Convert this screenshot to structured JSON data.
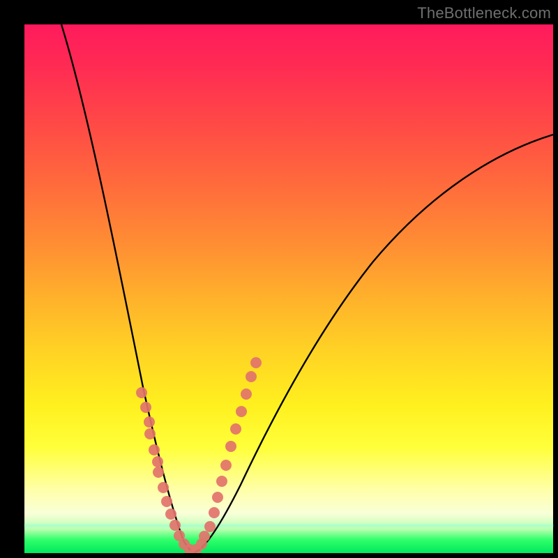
{
  "watermark": "TheBottleneck.com",
  "chart_data": {
    "type": "line",
    "title": "",
    "xlabel": "",
    "ylabel": "",
    "xlim": [
      0,
      100
    ],
    "ylim": [
      0,
      100
    ],
    "grid": false,
    "legend": false,
    "background_gradient": {
      "direction": "vertical",
      "stops": [
        {
          "pos": 0,
          "color": "#ff1f5a"
        },
        {
          "pos": 30,
          "color": "#ff6a3c"
        },
        {
          "pos": 62,
          "color": "#ffd324"
        },
        {
          "pos": 88,
          "color": "#ffffa8"
        },
        {
          "pos": 97,
          "color": "#2fff6a"
        },
        {
          "pos": 100,
          "color": "#00e85e"
        }
      ]
    },
    "series": [
      {
        "name": "left-branch",
        "stroke": "#000000",
        "x": [
          7,
          9,
          11,
          13,
          15,
          17,
          19,
          21,
          23,
          25,
          27,
          28.5,
          30,
          31
        ],
        "y": [
          100,
          90,
          80,
          70,
          60,
          50,
          40,
          31,
          23,
          15,
          8,
          4,
          1,
          0
        ]
      },
      {
        "name": "right-branch",
        "stroke": "#000000",
        "x": [
          31,
          33,
          36,
          40,
          45,
          51,
          58,
          66,
          75,
          85,
          95,
          100
        ],
        "y": [
          0,
          2,
          6,
          13,
          22,
          32,
          42,
          52,
          61,
          69,
          76,
          79
        ]
      },
      {
        "name": "left-dot-cluster",
        "type": "scatter",
        "color": "#e2736b",
        "x": [
          21.5,
          22.3,
          23.0,
          23.0,
          23.8,
          24.5,
          24.5,
          25.5,
          26.2,
          27.0,
          27.8,
          28.6,
          29.5,
          30.5
        ],
        "y": [
          30,
          27,
          24,
          22,
          19,
          17,
          15,
          12,
          9,
          7,
          5,
          3,
          1.5,
          0.5
        ]
      },
      {
        "name": "right-dot-cluster",
        "type": "scatter",
        "color": "#e2736b",
        "x": [
          31.5,
          32.5,
          33.0,
          34.0,
          34.8,
          35.5,
          36.3,
          37.0,
          38.0,
          39.0,
          40.0,
          41.0,
          42.0,
          43.0
        ],
        "y": [
          0.5,
          1.5,
          3,
          5,
          8,
          11,
          14,
          17,
          21,
          24,
          27,
          30,
          33,
          35
        ]
      }
    ],
    "notes": "V-shaped bottleneck curve on rainbow gradient background; pink/coral dots highlight segments near the trough on both branches; values estimated from pixel positions."
  }
}
